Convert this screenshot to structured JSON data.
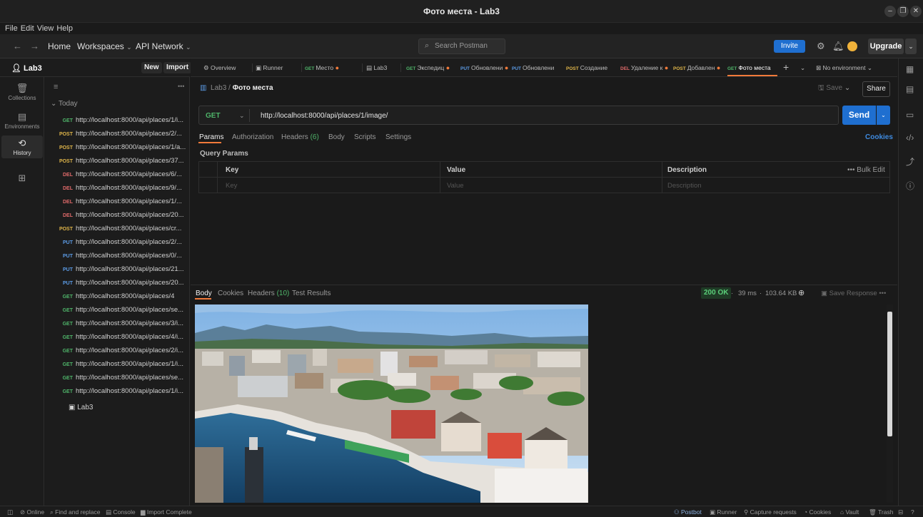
{
  "window": {
    "title": "Фото места - Lab3"
  },
  "menu": [
    "File",
    "Edit",
    "View",
    "Help"
  ],
  "topnav": {
    "home": "Home",
    "workspaces": "Workspaces",
    "api_network": "API Network",
    "search_placeholder": "Search Postman",
    "invite": "Invite",
    "upgrade": "Upgrade"
  },
  "workspace": {
    "name": "Lab3",
    "new_label": "New",
    "import_label": "Import"
  },
  "rail": [
    {
      "label": "Collections",
      "icon": "collections-icon"
    },
    {
      "label": "Environments",
      "icon": "environments-icon"
    },
    {
      "label": "History",
      "icon": "history-icon",
      "active": true
    },
    {
      "label": "",
      "icon": "apps-icon"
    }
  ],
  "history": {
    "group": "Today",
    "items": [
      {
        "method": "GET",
        "url": "http://localhost:8000/api/places/1/i..."
      },
      {
        "method": "POST",
        "url": "http://localhost:8000/api/places/2/..."
      },
      {
        "method": "POST",
        "url": "http://localhost:8000/api/places/1/a..."
      },
      {
        "method": "POST",
        "url": "http://localhost:8000/api/places/37..."
      },
      {
        "method": "DEL",
        "url": "http://localhost:8000/api/places/6/..."
      },
      {
        "method": "DEL",
        "url": "http://localhost:8000/api/places/9/..."
      },
      {
        "method": "DEL",
        "url": "http://localhost:8000/api/places/1/..."
      },
      {
        "method": "DEL",
        "url": "http://localhost:8000/api/places/20..."
      },
      {
        "method": "POST",
        "url": "http://localhost:8000/api/places/cr..."
      },
      {
        "method": "PUT",
        "url": "http://localhost:8000/api/places/2/..."
      },
      {
        "method": "PUT",
        "url": "http://localhost:8000/api/places/0/..."
      },
      {
        "method": "PUT",
        "url": "http://localhost:8000/api/places/21..."
      },
      {
        "method": "PUT",
        "url": "http://localhost:8000/api/places/20..."
      },
      {
        "method": "GET",
        "url": "http://localhost:8000/api/places/4"
      },
      {
        "method": "GET",
        "url": "http://localhost:8000/api/places/se..."
      },
      {
        "method": "GET",
        "url": "http://localhost:8000/api/places/3/i..."
      },
      {
        "method": "GET",
        "url": "http://localhost:8000/api/places/4/i..."
      },
      {
        "method": "GET",
        "url": "http://localhost:8000/api/places/2/i..."
      },
      {
        "method": "GET",
        "url": "http://localhost:8000/api/places/1/i..."
      },
      {
        "method": "GET",
        "url": "http://localhost:8000/api/places/se..."
      },
      {
        "method": "GET",
        "url": "http://localhost:8000/api/places/1/i..."
      }
    ],
    "collection": "Lab3"
  },
  "tabs": [
    {
      "method": "",
      "label": "Overview"
    },
    {
      "method": "",
      "label": "Runner"
    },
    {
      "method": "GET",
      "label": "Место",
      "dot": true
    },
    {
      "method": "",
      "label": "Lab3"
    },
    {
      "method": "GET",
      "label": "Экспедиц",
      "dot": true
    },
    {
      "method": "PUT",
      "label": "Обновлени",
      "dot": true
    },
    {
      "method": "PUT",
      "label": "Обновлени"
    },
    {
      "method": "POST",
      "label": "Создание"
    },
    {
      "method": "DEL",
      "label": "Удаление к",
      "dot": true
    },
    {
      "method": "POST",
      "label": "Добавлен",
      "dot": true
    },
    {
      "method": "GET",
      "label": "Фото места",
      "active": true
    }
  ],
  "environment": "No environment",
  "request": {
    "breadcrumb_parent": "Lab3",
    "breadcrumb_current": "Фото места",
    "save": "Save",
    "share": "Share",
    "method": "GET",
    "url": "http://localhost:8000/api/places/1/image/",
    "send": "Send",
    "tabs": {
      "params": "Params",
      "authorization": "Authorization",
      "headers": "Headers",
      "headers_count": "(6)",
      "body": "Body",
      "scripts": "Scripts",
      "settings": "Settings"
    },
    "cookies": "Cookies",
    "query_params_title": "Query Params",
    "table": {
      "key": "Key",
      "value": "Value",
      "description": "Description",
      "bulk_edit": "Bulk Edit",
      "key_placeholder": "Key",
      "value_placeholder": "Value",
      "description_placeholder": "Description"
    }
  },
  "response": {
    "tabs": {
      "body": "Body",
      "cookies": "Cookies",
      "headers": "Headers",
      "headers_count": "(10)",
      "test_results": "Test Results"
    },
    "status": "200 OK",
    "time": "39 ms",
    "size": "103.64 KB",
    "save_response": "Save Response"
  },
  "statusbar": {
    "online": "Online",
    "find_replace": "Find and replace",
    "console": "Console",
    "import_complete": "Import Complete",
    "postbot": "Postbot",
    "runner": "Runner",
    "capture": "Capture requests",
    "cookies": "Cookies",
    "vault": "Vault",
    "trash": "Trash"
  },
  "colors": {
    "accent": "#f27a3a",
    "send": "#1f6fd0",
    "get": "#4fb56a",
    "post": "#e0b64a",
    "put": "#5c9ce6",
    "del": "#e06a6a"
  }
}
